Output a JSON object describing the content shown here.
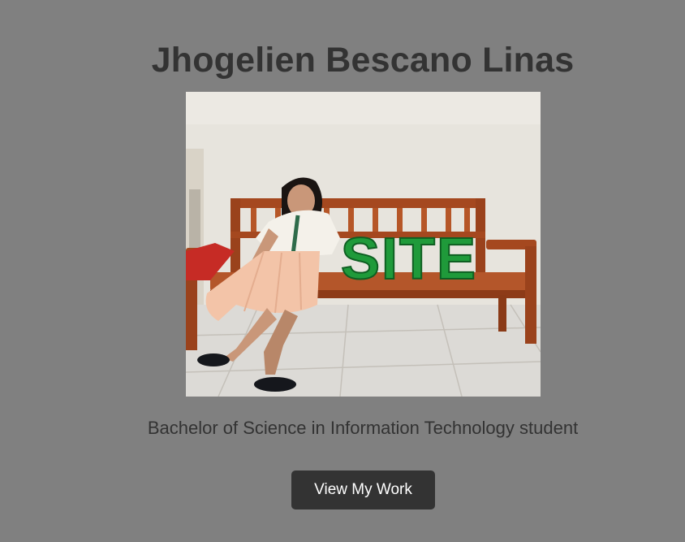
{
  "profile": {
    "name": "Jhogelien Bescano Linas",
    "photo_description": "Portrait photo of student seated on wooden bench",
    "photo_sign_text": "SITE",
    "tagline": "Bachelor of Science in Information Technology student"
  },
  "actions": {
    "view_work_label": "View My Work"
  },
  "colors": {
    "page_background": "#808080",
    "heading_text": "#333333",
    "button_background": "#333333",
    "button_text": "#ffffff",
    "sign_green": "#1f9a3a"
  }
}
